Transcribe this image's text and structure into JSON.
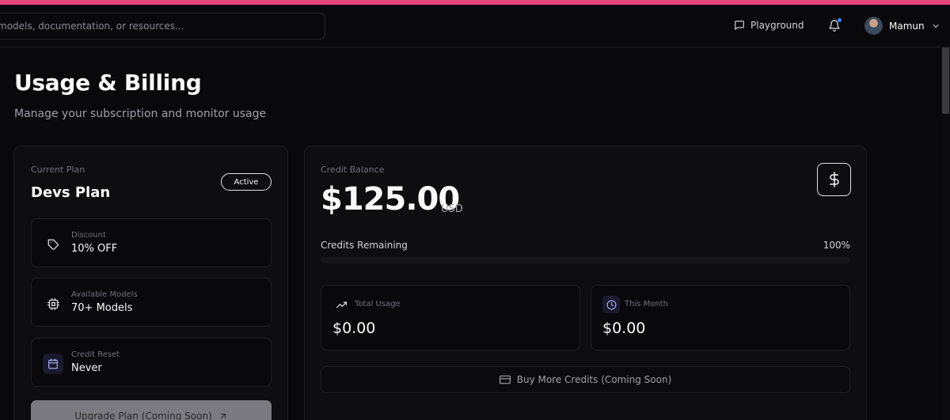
{
  "header": {
    "search_placeholder": "models, documentation, or resources...",
    "playground_label": "Playground",
    "user_name": "Mamun"
  },
  "page": {
    "title": "Usage & Billing",
    "subtitle": "Manage your subscription and monitor usage"
  },
  "plan": {
    "label": "Current Plan",
    "name": "Devs Plan",
    "status": "Active",
    "features": [
      {
        "label": "Discount",
        "value": "10% OFF",
        "icon": "tag-icon"
      },
      {
        "label": "Available Models",
        "value": "70+ Models",
        "icon": "cpu-icon"
      },
      {
        "label": "Credit Reset",
        "value": "Never",
        "icon": "calendar-icon"
      }
    ],
    "upgrade_label": "Upgrade Plan (Coming Soon)"
  },
  "credit": {
    "label": "Credit Balance",
    "amount": "$125.00",
    "currency": "USD",
    "remaining_label": "Credits Remaining",
    "remaining_percent": "100%",
    "remaining_fraction": 1.0,
    "total_usage_label": "Total Usage",
    "total_usage_value": "$0.00",
    "this_month_label": "This Month",
    "this_month_value": "$0.00",
    "buy_label": "Buy More Credits (Coming Soon)"
  },
  "colors": {
    "accent": "#e8467c",
    "background": "#09090b",
    "notification_dot": "#3b82f6"
  }
}
